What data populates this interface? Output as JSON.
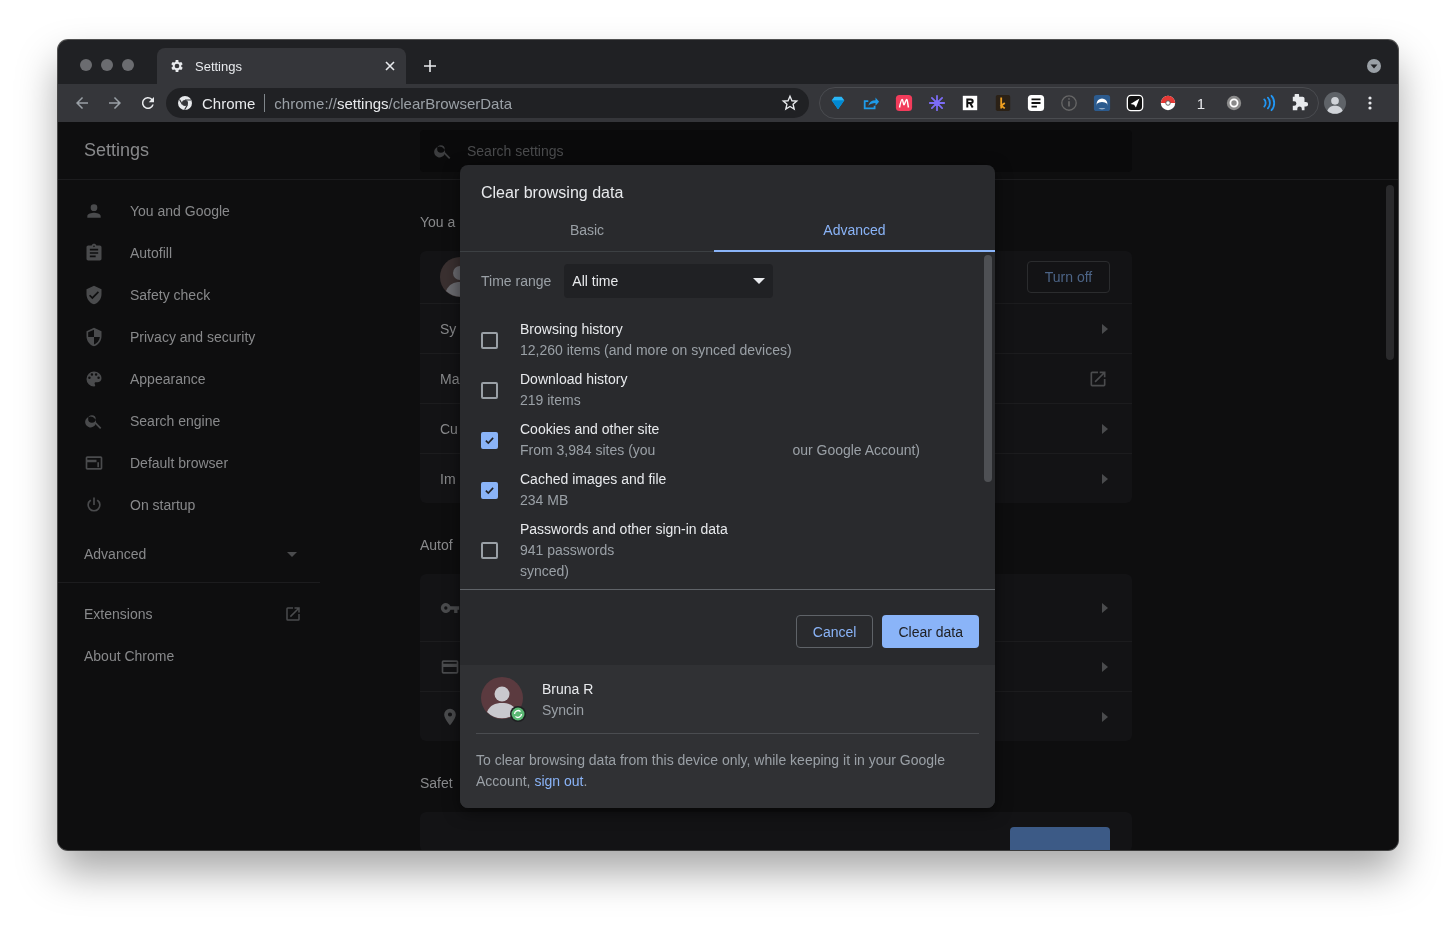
{
  "browser": {
    "tab": {
      "title": "Settings"
    },
    "address": {
      "site_label": "Chrome",
      "url_scheme": "chrome://",
      "url_host": "settings",
      "url_path": "/clearBrowserData"
    },
    "extension_badge": "1"
  },
  "settings": {
    "title": "Settings",
    "search": {
      "placeholder": "Search settings"
    },
    "sidebar": {
      "items": [
        {
          "label": "You and Google",
          "kind": "person"
        },
        {
          "label": "Autofill",
          "kind": "clipboard"
        },
        {
          "label": "Safety check",
          "kind": "shield-check"
        },
        {
          "label": "Privacy and security",
          "kind": "shield"
        },
        {
          "label": "Appearance",
          "kind": "palette"
        },
        {
          "label": "Search engine",
          "kind": "search"
        },
        {
          "label": "Default browser",
          "kind": "browser"
        },
        {
          "label": "On startup",
          "kind": "power"
        }
      ],
      "advanced": {
        "label": "Advanced",
        "expanded": false
      },
      "links": [
        {
          "label": "Extensions",
          "external": true
        },
        {
          "label": "About Chrome",
          "external": false
        }
      ]
    },
    "sections": [
      {
        "title": "You a",
        "rows": [
          {
            "kind": "account",
            "button": "Turn off"
          },
          {
            "kind": "arrow",
            "label": "Sy"
          },
          {
            "kind": "external",
            "label": "Ma"
          },
          {
            "kind": "arrow",
            "label": "Cu"
          },
          {
            "kind": "arrow",
            "label": "Im"
          }
        ]
      },
      {
        "title": "Autof",
        "rows": [
          {
            "kind": "key"
          },
          {
            "kind": "card"
          },
          {
            "kind": "pin"
          }
        ]
      },
      {
        "title": "Safet",
        "rows": [
          {
            "kind": "action"
          }
        ]
      }
    ]
  },
  "dialog": {
    "title": "Clear browsing data",
    "tabs": [
      {
        "label": "Basic",
        "selected": false
      },
      {
        "label": "Advanced",
        "selected": true
      }
    ],
    "time_range": {
      "label": "Time range",
      "value": "All time"
    },
    "items": [
      {
        "title": "Browsing history",
        "details": [
          [
            "12,260 items (and more on synced devices)"
          ]
        ],
        "checked": false
      },
      {
        "title": "Download history",
        "details": [
          [
            "219 items"
          ]
        ],
        "checked": false
      },
      {
        "title": "Cookies and other site",
        "details": [
          [
            "From 3,984 sites (you",
            "our Google Account)"
          ]
        ],
        "checked": true
      },
      {
        "title": "Cached images and file",
        "details": [
          [
            "234 MB"
          ]
        ],
        "checked": true
      },
      {
        "title": "Passwords and other sign-in data",
        "details": [
          [
            "941 passwords"
          ],
          [
            "synced)"
          ]
        ],
        "checked": false
      }
    ],
    "buttons": [
      {
        "label": "Cancel",
        "kind": "secondary"
      },
      {
        "label": "Clear data",
        "kind": "primary"
      }
    ],
    "account": {
      "name": "Bruna R",
      "status": "Syncin"
    },
    "note": {
      "text": "To clear browsing data from this device only, while keeping it in your Google Account, ",
      "link": "sign out",
      "end": "."
    }
  }
}
